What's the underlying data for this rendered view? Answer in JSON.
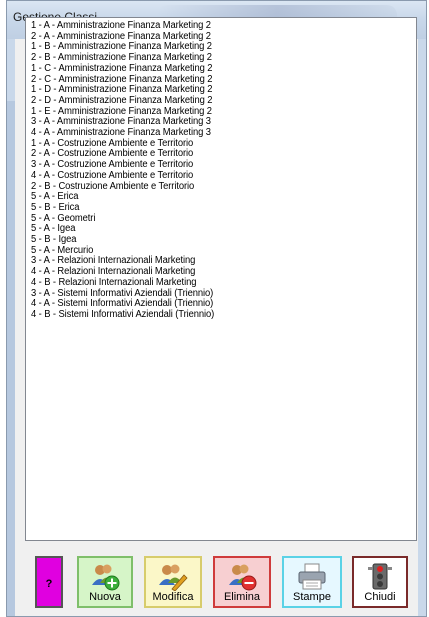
{
  "window": {
    "title": "Gestione Classi"
  },
  "classes": [
    "1 - A - Amministrazione Finanza Marketing 2",
    "2 - A - Amministrazione Finanza Marketing 2",
    "1 - B - Amministrazione Finanza Marketing 2",
    "2 - B - Amministrazione Finanza Marketing 2",
    "1 - C - Amministrazione Finanza Marketing 2",
    "2 - C - Amministrazione Finanza Marketing 2",
    "1 - D - Amministrazione Finanza Marketing 2",
    "2 - D - Amministrazione Finanza Marketing 2",
    "1 - E - Amministrazione Finanza Marketing 2",
    "3 - A - Amministrazione Finanza Marketing 3",
    "4 - A - Amministrazione Finanza Marketing 3",
    "1 - A - Costruzione Ambiente e Territorio",
    "2 - A - Costruzione Ambiente e Territorio",
    "3 - A - Costruzione Ambiente e Territorio",
    "4 - A - Costruzione Ambiente e Territorio",
    "2 - B - Costruzione Ambiente e Territorio",
    "5 - A - Erica",
    "5 - B - Erica",
    "5 - A - Geometri",
    "5 - A - Igea",
    "5 - B - Igea",
    "5 - A - Mercurio",
    "3 - A - Relazioni Internazionali Marketing",
    "4 - A - Relazioni Internazionali Marketing",
    "4 - B - Relazioni Internazionali Marketing",
    "3 - A - Sistemi Informativi Aziendali (Triennio)",
    "4 - A - Sistemi Informativi Aziendali (Triennio)",
    "4 - B - Sistemi Informativi Aziendali (Triennio)"
  ],
  "buttons": {
    "help": "?",
    "nuova": "Nuova",
    "modifica": "Modifica",
    "elimina": "Elimina",
    "stampe": "Stampe",
    "chiudi": "Chiudi"
  }
}
